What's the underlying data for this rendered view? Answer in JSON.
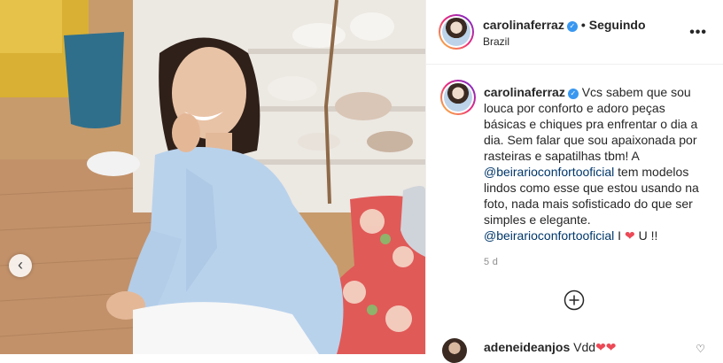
{
  "header": {
    "username": "carolinaferraz",
    "separator": "•",
    "follow_status": "Seguindo",
    "location": "Brazil"
  },
  "caption": {
    "username": "carolinaferraz",
    "text_1": "Vcs sabem que sou louca por conforto e adoro peças básicas e chiques pra enfrentar o dia a dia. Sem falar que sou apaixonada por rasteiras e sapatilhas tbm! A",
    "mention_1": "@beirarioconfortooficial",
    "text_2": "tem modelos lindos como esse que estou usando na foto, nada mais sofisticado do que ser simples e elegante.",
    "mention_2": "@beirarioconfortooficial",
    "text_3": "I",
    "heart": "❤",
    "text_4": "U !!",
    "age": "5 d"
  },
  "comment": {
    "username": "adeneideanjos",
    "text": "Vdd",
    "hearts": "❤❤"
  },
  "icons": {
    "verified": "✓",
    "more": "•••",
    "prev": "‹",
    "like": "♡"
  },
  "colors": {
    "mention": "#00376b",
    "verified": "#3897f0",
    "heart": "#ed4956"
  }
}
